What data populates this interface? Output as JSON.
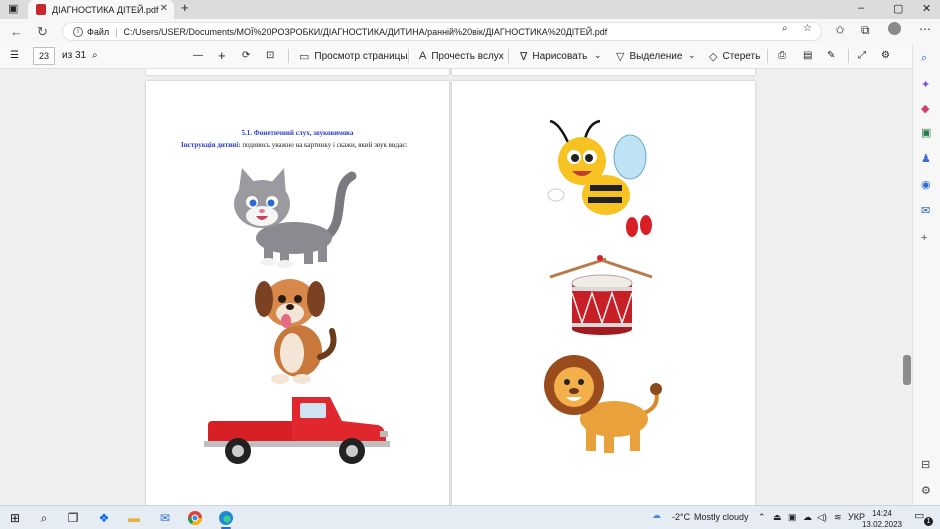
{
  "browser": {
    "tab_title": "ДІАГНОСТИКА ДІТЕЙ.pdf",
    "tab_close": "✕",
    "new_tab": "+",
    "address_prefix": "Файл",
    "address_url": "C:/Users/USER/Documents/МОЇ%20РОЗРОБКИ/ДІАГНОСТИКА/ДИТИНА/ранній%20вік/ДІАГНОСТИКА%20ДІТЕЙ.pdf",
    "window_minimize": "–",
    "window_maximize": "▢",
    "window_close": "✕"
  },
  "pdf_toolbar": {
    "page_current": "23",
    "page_total": "из 31",
    "zoom_out": "—",
    "zoom_in": "+",
    "page_view_label": "Просмотр страницы",
    "read_aloud_label": "Прочесть вслух",
    "draw_label": "Нарисовать",
    "highlight_label": "Выделение",
    "erase_label": "Стереть"
  },
  "document": {
    "title": "5.1. Фонетичний слух, звуковимова",
    "instruction_bold": "Інструкція дитині:",
    "instruction_text": "подивись уважно на картинку і скажи, який звук видає:",
    "left_pictures": [
      "cat",
      "dog",
      "truck"
    ],
    "right_pictures": [
      "bee",
      "drum",
      "lion"
    ]
  },
  "taskbar": {
    "weather_temp": "-2°C",
    "weather_desc": "Mostly cloudy",
    "language": "УКР",
    "time": "14:24",
    "date": "13.02.2023",
    "notifications": "1"
  },
  "colors": {
    "title_blue": "#2b3bd0",
    "taskbar_bg": "#e6ecf3",
    "tab_pdf_red": "#c8282d"
  }
}
